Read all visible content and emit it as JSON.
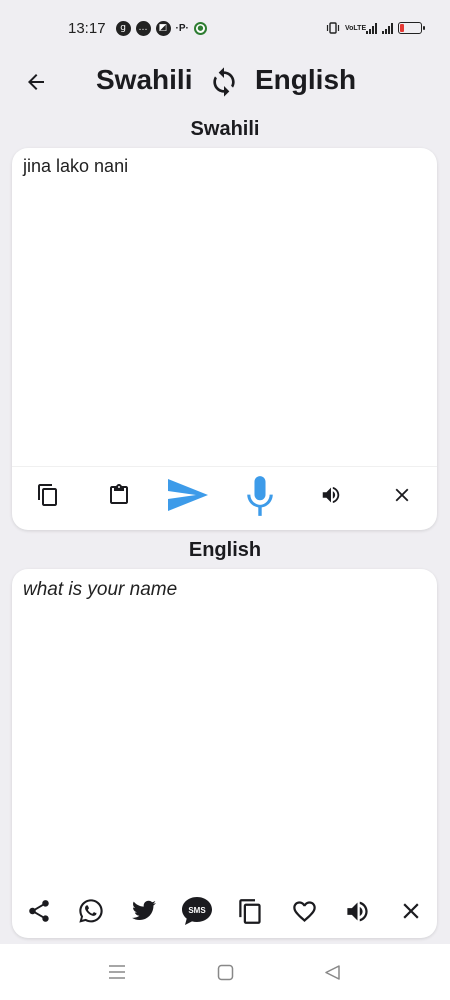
{
  "status": {
    "time": "13:17",
    "network_label": "VoLTE",
    "battery_color": "#e53935"
  },
  "header": {
    "source_language": "Swahili",
    "target_language": "English"
  },
  "source_panel": {
    "label": "Swahili",
    "text": "jina lako nani"
  },
  "target_panel": {
    "label": "English",
    "text": "what is your name"
  },
  "colors": {
    "accent": "#3d9be9",
    "background": "#efeef2",
    "card": "#ffffff",
    "icon": "#1b1b1f"
  }
}
